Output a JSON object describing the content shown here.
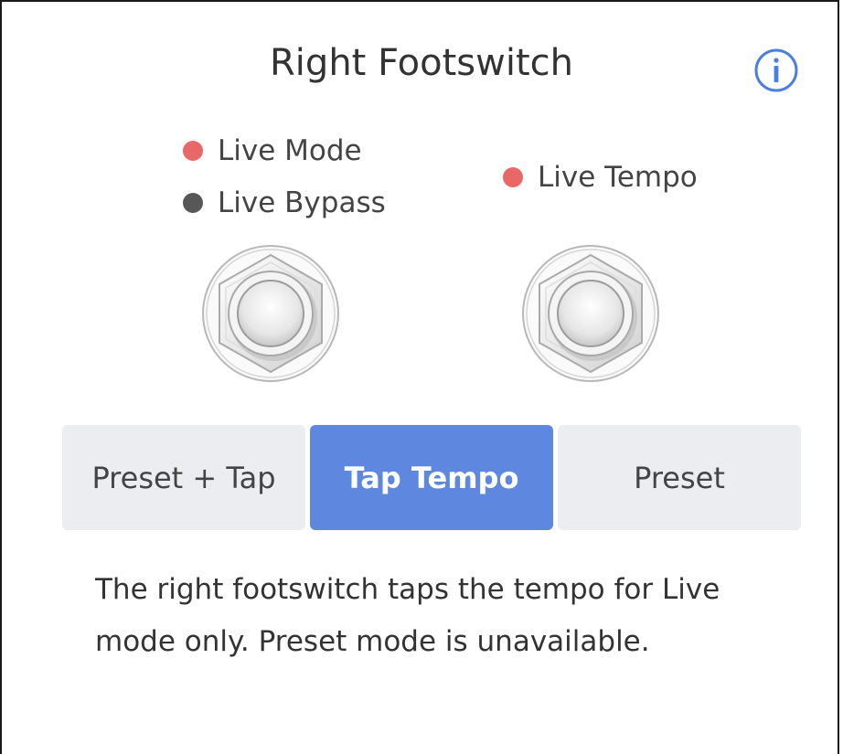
{
  "header": {
    "title": "Right Footswitch",
    "info_icon": "info-circle-icon"
  },
  "indicators": {
    "left": [
      {
        "label": "Live Mode",
        "color": "#e86868"
      },
      {
        "label": "Live Bypass",
        "color": "#575757"
      }
    ],
    "right": [
      {
        "label": "Live Tempo",
        "color": "#e86868"
      }
    ]
  },
  "footswitches": {
    "icon": "footswitch-icon"
  },
  "mode_selector": {
    "options": [
      "Preset + Tap",
      "Tap Tempo",
      "Preset"
    ],
    "selected": "Tap Tempo",
    "accent_color": "#5e88df"
  },
  "description": "The right footswitch taps the tempo for Live mode only. Preset mode is unavailable."
}
